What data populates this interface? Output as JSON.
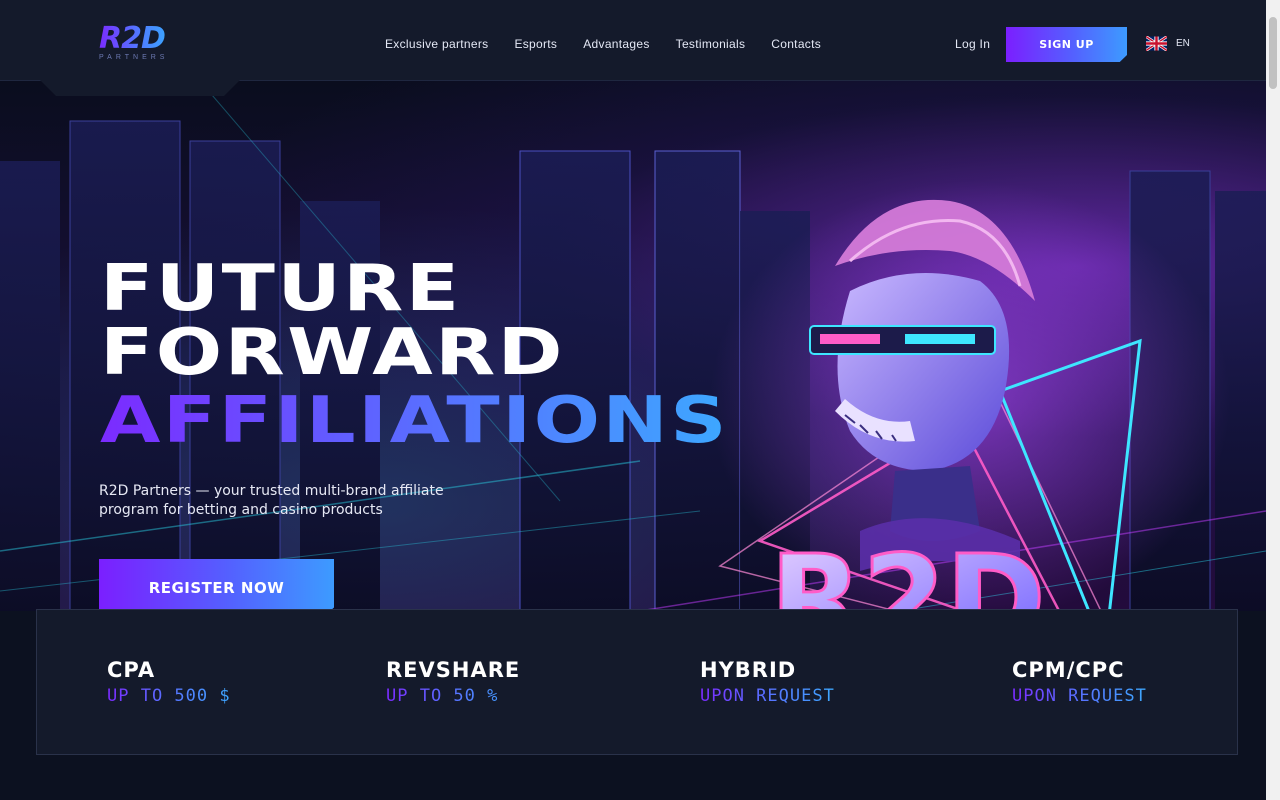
{
  "brand": {
    "name": "R2D",
    "tagline": "PARTNERS"
  },
  "nav": {
    "items": [
      {
        "label": "Exclusive partners"
      },
      {
        "label": "Esports"
      },
      {
        "label": "Advantages"
      },
      {
        "label": "Testimonials"
      },
      {
        "label": "Contacts"
      }
    ]
  },
  "auth": {
    "login_label": "Log In",
    "signup_label": "SIGN UP"
  },
  "language": {
    "code": "EN",
    "flag_icon": "uk-flag-icon"
  },
  "hero": {
    "title_line1": "FUTURE",
    "title_line2": "FORWARD",
    "title_line3": "AFFILIATIONS",
    "subtitle": "R2D Partners — your trusted multi-brand affiliate program for betting and casino products",
    "cta_label": "REGISTER NOW",
    "mascot_text": "R2D"
  },
  "stats": [
    {
      "title": "CPA",
      "value": "UP TO 500 $"
    },
    {
      "title": "REVSHARE",
      "value": "UP TO 50 %"
    },
    {
      "title": "HYBRID",
      "value": "UPON REQUEST"
    },
    {
      "title": "CPM/CPC",
      "value": "UPON REQUEST"
    }
  ],
  "colors": {
    "accent_purple": "#7b1fff",
    "accent_blue": "#3d9bff",
    "header_bg": "#141a2b",
    "page_bg": "#0c1120"
  }
}
